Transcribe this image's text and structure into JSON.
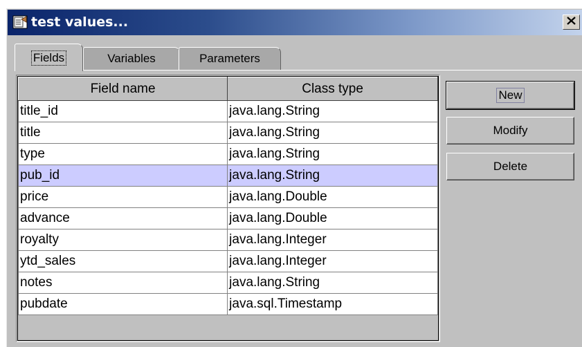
{
  "window": {
    "title": "test values...",
    "close_label": "×"
  },
  "tabs": [
    {
      "label": "Fields",
      "active": true
    },
    {
      "label": "Variables",
      "active": false
    },
    {
      "label": "Parameters",
      "active": false
    }
  ],
  "table": {
    "columns": [
      "Field name",
      "Class type"
    ],
    "rows": [
      {
        "name": "title_id",
        "type": "java.lang.String"
      },
      {
        "name": "title",
        "type": "java.lang.String"
      },
      {
        "name": "type",
        "type": "java.lang.String"
      },
      {
        "name": "pub_id",
        "type": "java.lang.String",
        "selected": true
      },
      {
        "name": "price",
        "type": "java.lang.Double"
      },
      {
        "name": "advance",
        "type": "java.lang.Double"
      },
      {
        "name": "royalty",
        "type": "java.lang.Integer"
      },
      {
        "name": "ytd_sales",
        "type": "java.lang.Integer"
      },
      {
        "name": "notes",
        "type": "java.lang.String"
      },
      {
        "name": "pubdate",
        "type": "java.sql.Timestamp"
      }
    ]
  },
  "buttons": {
    "new": "New",
    "modify": "Modify",
    "delete": "Delete"
  },
  "colors": {
    "selected_row": "#ccccff",
    "titlebar_start": "#0a246a",
    "titlebar_end": "#c3d3ec"
  }
}
